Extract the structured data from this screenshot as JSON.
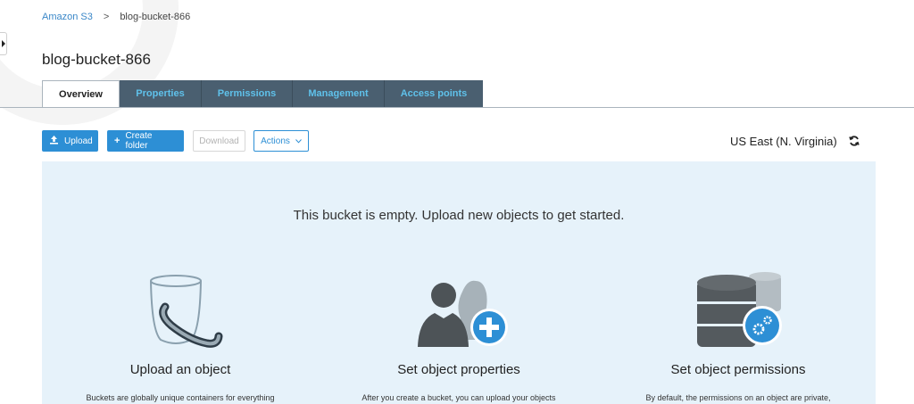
{
  "breadcrumb": {
    "root": "Amazon S3",
    "separator": ">",
    "current": "blog-bucket-866"
  },
  "page_title": "blog-bucket-866",
  "tabs": [
    {
      "label": "Overview",
      "active": true
    },
    {
      "label": "Properties",
      "active": false
    },
    {
      "label": "Permissions",
      "active": false
    },
    {
      "label": "Management",
      "active": false
    },
    {
      "label": "Access points",
      "active": false
    }
  ],
  "toolbar": {
    "upload_label": "Upload",
    "create_folder_label": "Create folder",
    "download_label": "Download",
    "actions_label": "Actions"
  },
  "region": {
    "label": "US East (N. Virginia)",
    "icon": "refresh-icon"
  },
  "empty_state": {
    "message": "This bucket is empty. Upload new objects to get started.",
    "features": [
      {
        "title": "Upload an object",
        "description": "Buckets are globally unique containers for everything",
        "icon": "bucket-icon"
      },
      {
        "title": "Set object properties",
        "description": "After you create a bucket, you can upload your objects",
        "icon": "users-add-icon"
      },
      {
        "title": "Set object permissions",
        "description": "By default, the permissions on an object are private,",
        "icon": "database-gear-icon"
      }
    ]
  },
  "colors": {
    "primary": "#2d8fd5",
    "tab_bg": "#4a5f70",
    "tab_text": "#5fc1ea",
    "panel_bg": "#e6f2fa"
  }
}
